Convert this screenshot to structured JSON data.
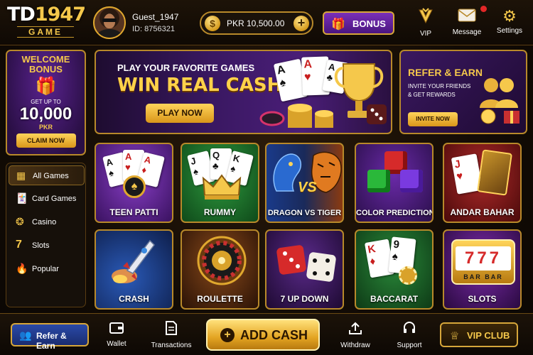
{
  "header": {
    "logo_main": "TD",
    "logo_num": "1947",
    "logo_sub": "GAME",
    "username": "Guest_1947",
    "user_id": "ID: 8756321",
    "balance": "PKR 10,500.00",
    "bonus_label": "BONUS",
    "icons": [
      {
        "label": "VIP",
        "icon": "vip-crown-icon"
      },
      {
        "label": "Message",
        "icon": "envelope-icon"
      },
      {
        "label": "Settings",
        "icon": "gear-icon"
      }
    ]
  },
  "welcome_bonus": {
    "title_line1": "WELCOME",
    "title_line2": "BONUS",
    "get_up_to": "GET UP TO",
    "amount": "10,000",
    "currency": "PKR",
    "cta": "CLAIM NOW"
  },
  "hero": {
    "line1": "PLAY YOUR FAVORITE GAMES",
    "line2": "WIN REAL CASH",
    "cta": "PLAY NOW"
  },
  "refer_banner": {
    "title": "REFER & EARN",
    "subtitle": "INVITE YOUR FRIENDS & GET REWARDS",
    "cta": "INVITE NOW"
  },
  "nav": {
    "items": [
      {
        "label": "All Games",
        "icon": "grid-icon",
        "active": true
      },
      {
        "label": "Card Games",
        "icon": "cards-icon",
        "active": false
      },
      {
        "label": "Casino",
        "icon": "chip-icon",
        "active": false
      },
      {
        "label": "Slots",
        "icon": "seven-icon",
        "active": false
      },
      {
        "label": "Popular",
        "icon": "flame-icon",
        "active": false
      }
    ]
  },
  "games": [
    {
      "name": "TEEN PATTI",
      "color": "#5a1f8a"
    },
    {
      "name": "RUMMY",
      "color": "#1e6a2a"
    },
    {
      "name": "DRAGON VS TIGER",
      "color": "#1a2e66"
    },
    {
      "name": "COLOR PREDICTION",
      "color": "#4a1e7a"
    },
    {
      "name": "ANDAR BAHAR",
      "color": "#7a1a1a"
    },
    {
      "name": "CRASH",
      "color": "#1a3a7a"
    },
    {
      "name": "ROULETTE",
      "color": "#5a2a0a"
    },
    {
      "name": "7 UP DOWN",
      "color": "#3a1a5a"
    },
    {
      "name": "BACCARAT",
      "color": "#1a5a2a"
    },
    {
      "name": "SLOTS",
      "color": "#4a1a6a"
    }
  ],
  "bottom": {
    "refer": "Refer & Earn",
    "wallet": "Wallet",
    "transactions": "Transactions",
    "add_cash": "ADD CASH",
    "withdraw": "Withdraw",
    "support": "Support",
    "vip_club": "VIP CLUB"
  }
}
